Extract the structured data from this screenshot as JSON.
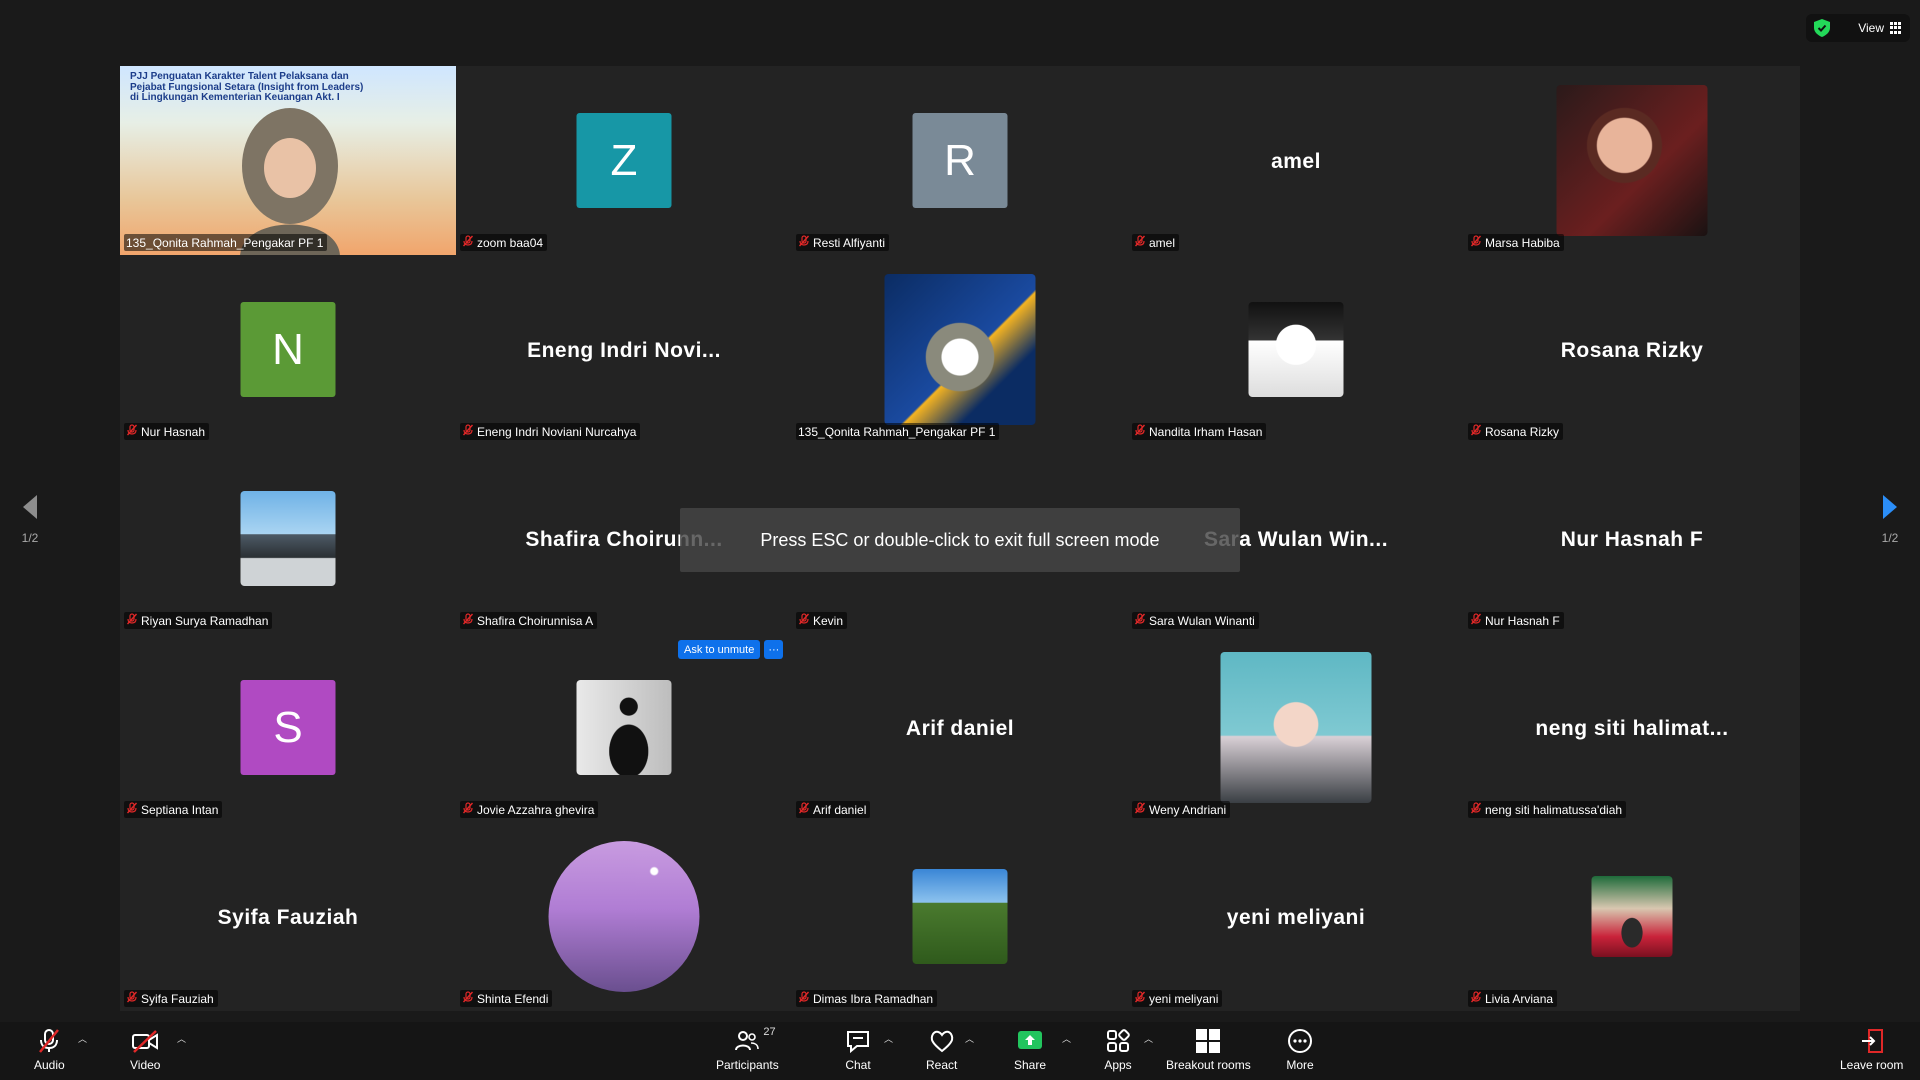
{
  "view_label": "View",
  "page_indicator": "1/2",
  "esc_hint": "Press ESC or double-click to exit full screen mode",
  "ask_to_unmute": "Ask to unmute",
  "ask_more": "···",
  "presenter_banner": [
    "PJJ Penguatan Karakter Talent Pelaksana dan",
    "Pejabat Fungsional Setara (Insight from Leaders)",
    "di Lingkungan Kementerian Keuangan Akt. I"
  ],
  "tiles": [
    {
      "name": "135_Qonita Rahmah_Pengakar PF 1",
      "type": "presenter",
      "muted": false
    },
    {
      "name": "zoom baa04",
      "type": "letter",
      "letter": "Z",
      "color": "#1797a6",
      "muted": true
    },
    {
      "name": "Resti Alfiyanti",
      "type": "letter",
      "letter": "R",
      "color": "#7a8a97",
      "muted": true
    },
    {
      "name": "amel",
      "type": "text",
      "display": "amel",
      "muted": true
    },
    {
      "name": "Marsa Habiba",
      "type": "photo",
      "size": "lg",
      "style": "spider",
      "muted": true
    },
    {
      "name": "Nur Hasnah",
      "type": "letter",
      "letter": "N",
      "color": "#5b9a36",
      "muted": true
    },
    {
      "name": "Eneng Indri Noviani Nurcahya",
      "type": "text",
      "display": "Eneng  Indri  Novi...",
      "muted": true
    },
    {
      "name": "135_Qonita Rahmah_Pengakar PF 1",
      "type": "photo",
      "size": "lg",
      "style": "poster",
      "muted": false
    },
    {
      "name": "Nandita Irham Hasan",
      "type": "photo",
      "size": "sm",
      "style": "manga",
      "muted": true
    },
    {
      "name": "Rosana Rizky",
      "type": "text",
      "display": "Rosana Rizky",
      "muted": true
    },
    {
      "name": "Riyan Surya Ramadhan",
      "type": "photo",
      "size": "sm",
      "style": "mountain",
      "muted": true
    },
    {
      "name": "Shafira Choirunnisa A",
      "type": "text",
      "display": "Shafira  Choirunn...",
      "muted": true
    },
    {
      "name": "Kevin",
      "type": "text",
      "display": "",
      "muted": true
    },
    {
      "name": "Sara Wulan Winanti",
      "type": "text",
      "display": "Sara  Wulan  Win...",
      "muted": true
    },
    {
      "name": "Nur Hasnah F",
      "type": "text",
      "display": "Nur Hasnah F",
      "muted": true
    },
    {
      "name": "Septiana Intan",
      "type": "letter",
      "letter": "S",
      "color": "#b04ac2",
      "muted": true
    },
    {
      "name": "Jovie Azzahra ghevira",
      "type": "photo",
      "size": "sm",
      "style": "silhouette",
      "muted": true
    },
    {
      "name": "Arif daniel",
      "type": "text",
      "display": "Arif daniel",
      "muted": true
    },
    {
      "name": "Weny Andriani",
      "type": "photo",
      "size": "lg",
      "style": "hijab",
      "muted": true
    },
    {
      "name": "neng siti halimatussa'diah",
      "type": "text",
      "display": "neng  siti  halimat...",
      "muted": true
    },
    {
      "name": "Syifa Fauziah",
      "type": "text",
      "display": "Syifa Fauziah",
      "muted": true
    },
    {
      "name": "Shinta Efendi",
      "type": "photo",
      "size": "lg",
      "style": "blossom",
      "muted": true
    },
    {
      "name": "Dimas Ibra Ramadhan",
      "type": "photo",
      "size": "sm",
      "style": "forest",
      "muted": true
    },
    {
      "name": "yeni meliyani",
      "type": "text",
      "display": "yeni meliyani",
      "muted": true
    },
    {
      "name": "Livia Arviana",
      "type": "photo",
      "size": "xs",
      "style": "stage",
      "muted": true
    }
  ],
  "toolbar": {
    "audio": "Audio",
    "video": "Video",
    "participants": "Participants",
    "participants_count": "27",
    "chat": "Chat",
    "react": "React",
    "share": "Share",
    "apps": "Apps",
    "breakout": "Breakout rooms",
    "more": "More",
    "leave": "Leave room"
  },
  "colors": {
    "accent": "#0e71eb",
    "active_speaker": "#23d959",
    "mute": "#e02828",
    "share": "#22c55e"
  }
}
